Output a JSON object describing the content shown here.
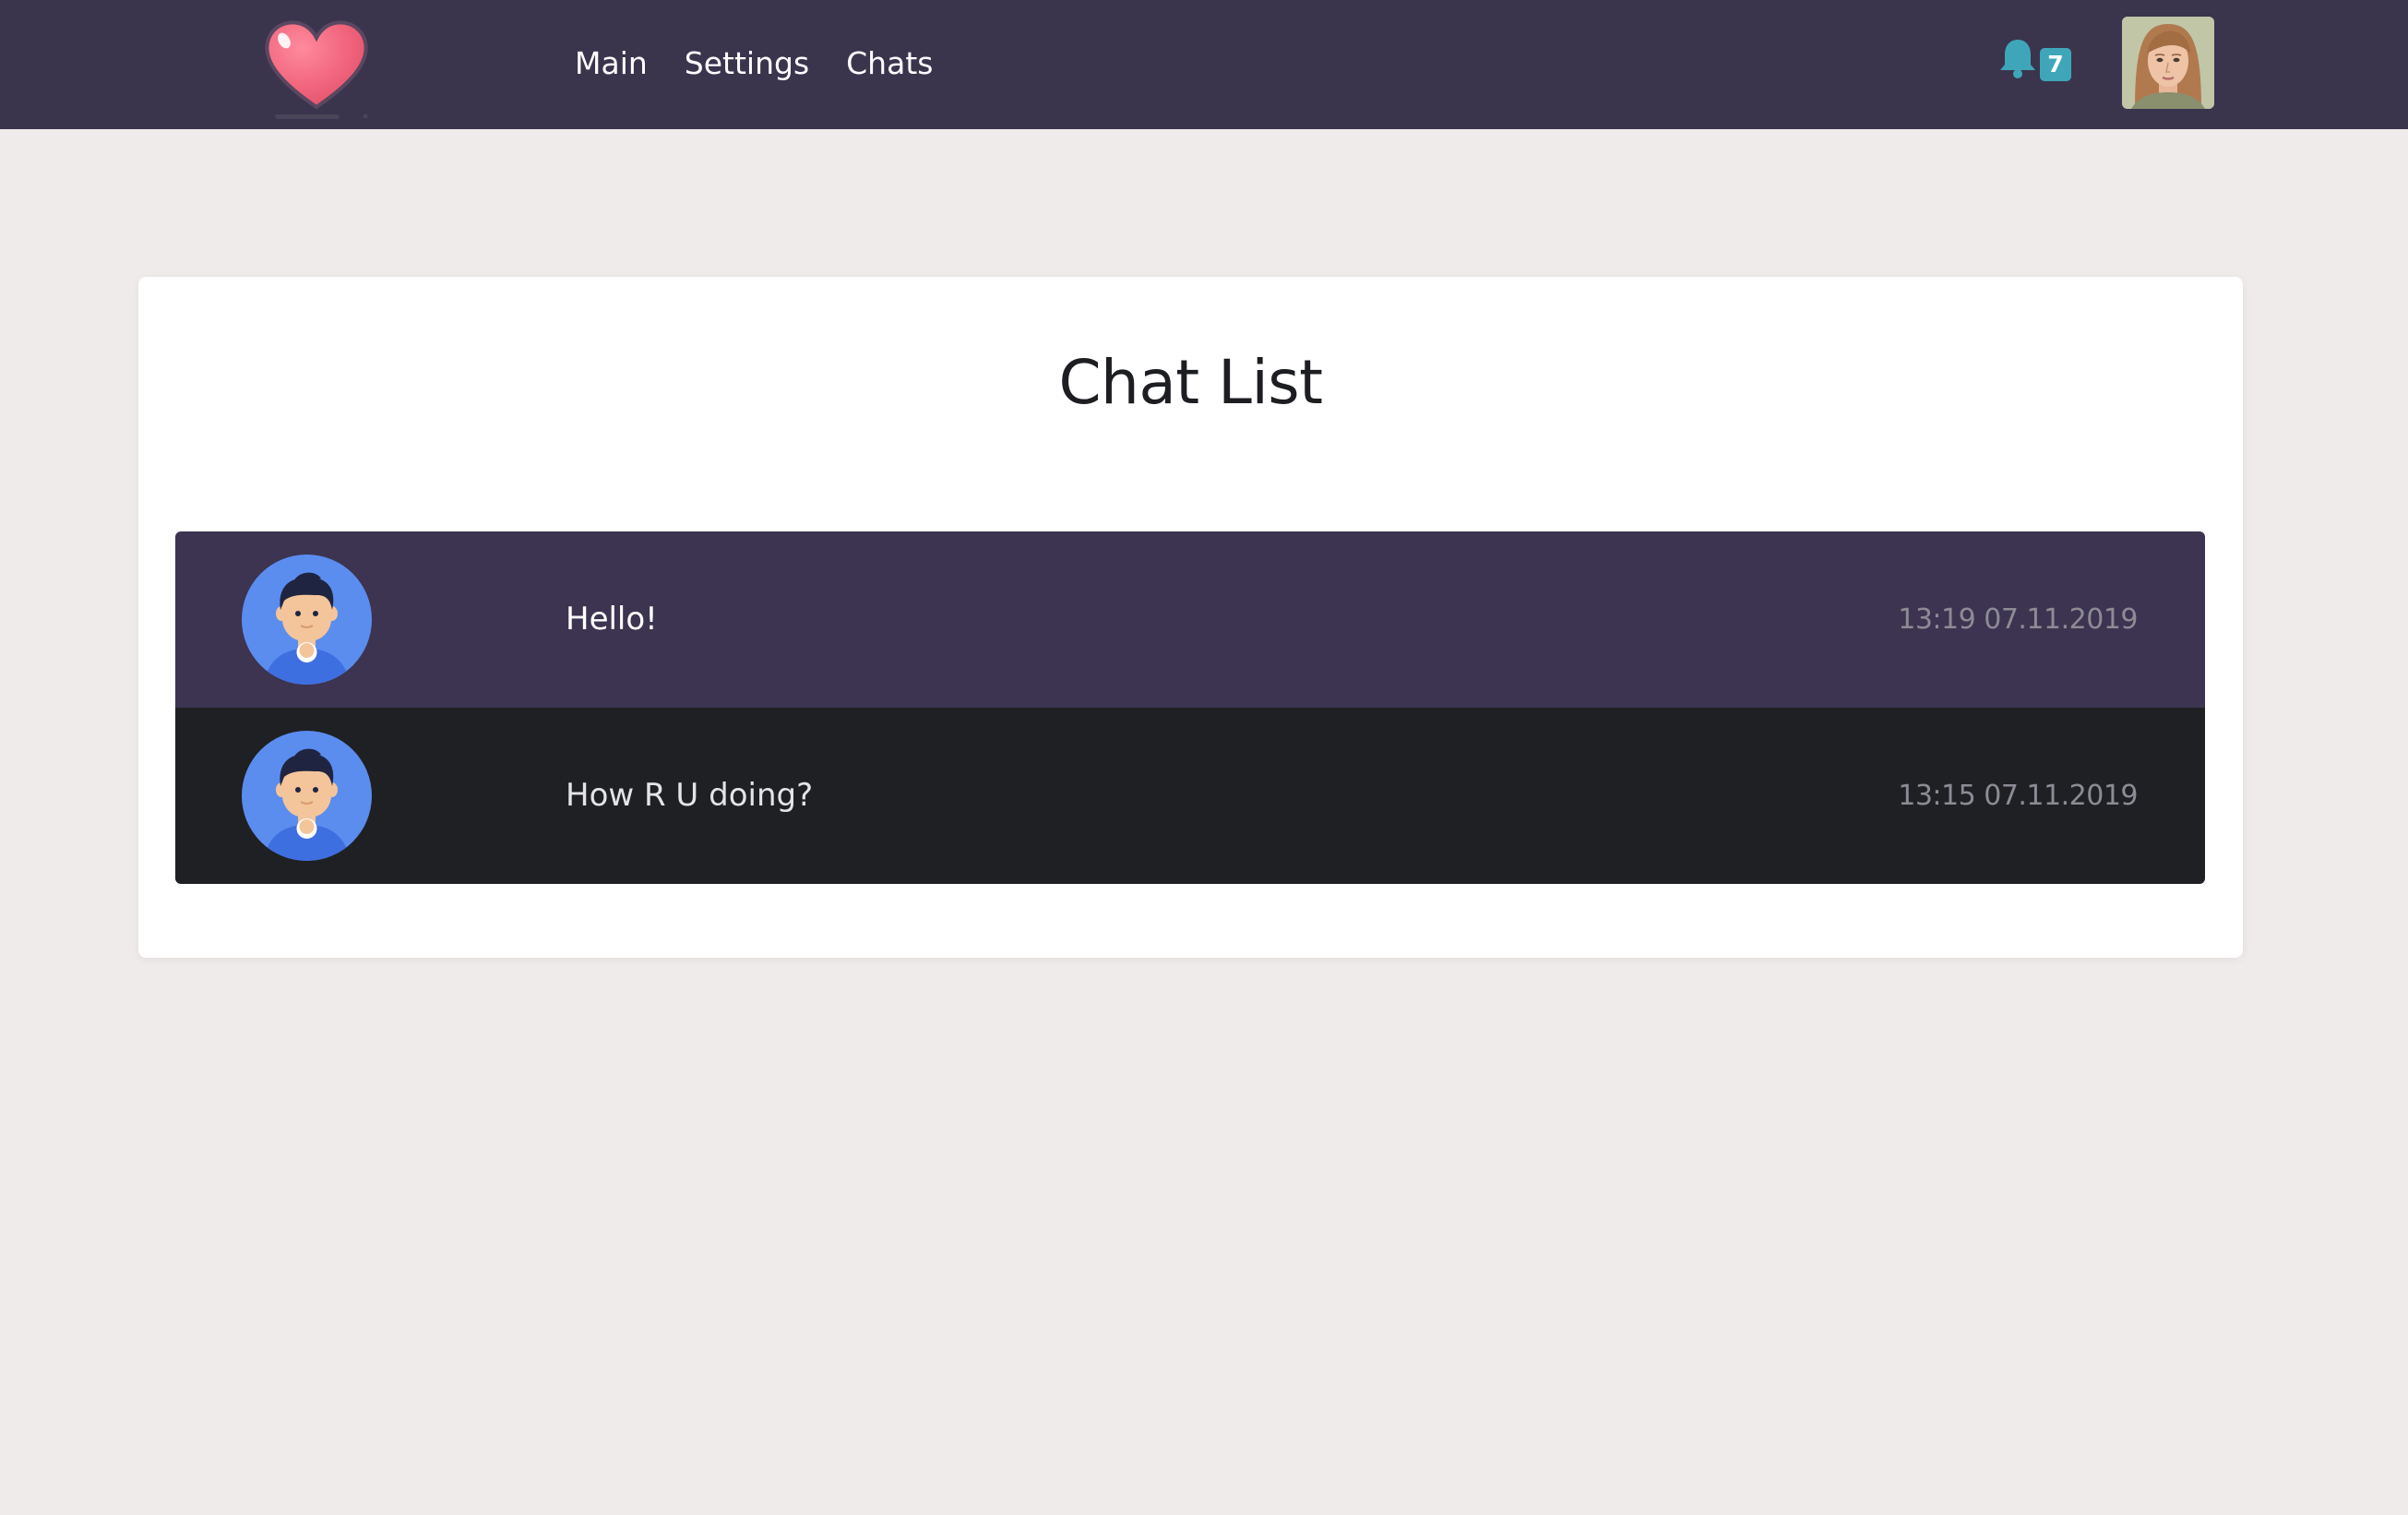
{
  "nav": {
    "logo_icon": "heart-icon",
    "links": [
      "Main",
      "Settings",
      "Chats"
    ],
    "notification_icon": "bell-icon",
    "notification_count": "7",
    "user_avatar_icon": "user-avatar-photo"
  },
  "colors": {
    "navbar": "#3b344d",
    "page_background": "#efebea",
    "card": "#ffffff",
    "row_highlight": "#3c3450",
    "row_dark": "#1f2024",
    "badge": "#3fa6b9",
    "bell": "#3fa6b9",
    "heart": "#f0647c",
    "avatar_circle": "#5b8def"
  },
  "main": {
    "title": "Chat List",
    "chats": [
      {
        "message": "Hello!",
        "time": "13:19 07.11.2019",
        "avatar_icon": "user-avatar-icon"
      },
      {
        "message": "How R U doing?",
        "time": "13:15 07.11.2019",
        "avatar_icon": "user-avatar-icon"
      }
    ]
  }
}
